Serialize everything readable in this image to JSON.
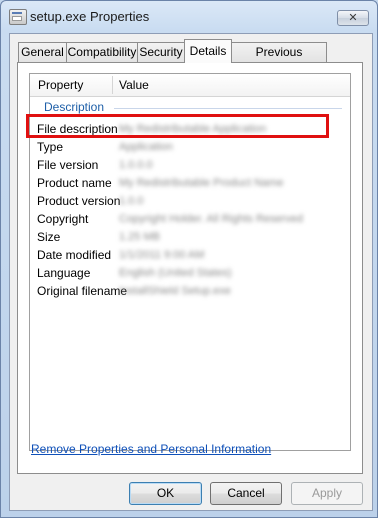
{
  "window": {
    "title": "setup.exe Properties",
    "close_label": "✕"
  },
  "tabs": [
    "General",
    "Compatibility",
    "Security",
    "Details",
    "Previous Versions"
  ],
  "list": {
    "columns": {
      "property": "Property",
      "value": "Value"
    },
    "group": "Description",
    "rows": [
      {
        "property": "File description",
        "value": "My Redistributable Application"
      },
      {
        "property": "Type",
        "value": "Application"
      },
      {
        "property": "File version",
        "value": "1.0.0.0"
      },
      {
        "property": "Product name",
        "value": "My Redistributable Product Name"
      },
      {
        "property": "Product version",
        "value": "1.0.0"
      },
      {
        "property": "Copyright",
        "value": "Copyright Holder. All Rights Reserved"
      },
      {
        "property": "Size",
        "value": "1.25 MB"
      },
      {
        "property": "Date modified",
        "value": "1/1/2011 9:00 AM"
      },
      {
        "property": "Language",
        "value": "English (United States)"
      },
      {
        "property": "Original filename",
        "value": "InstallShield Setup.exe"
      }
    ]
  },
  "remove_link": "Remove Properties and Personal Information",
  "buttons": {
    "ok": "OK",
    "cancel": "Cancel",
    "apply": "Apply"
  },
  "highlight": {
    "target": "File description",
    "color": "#e01010"
  }
}
